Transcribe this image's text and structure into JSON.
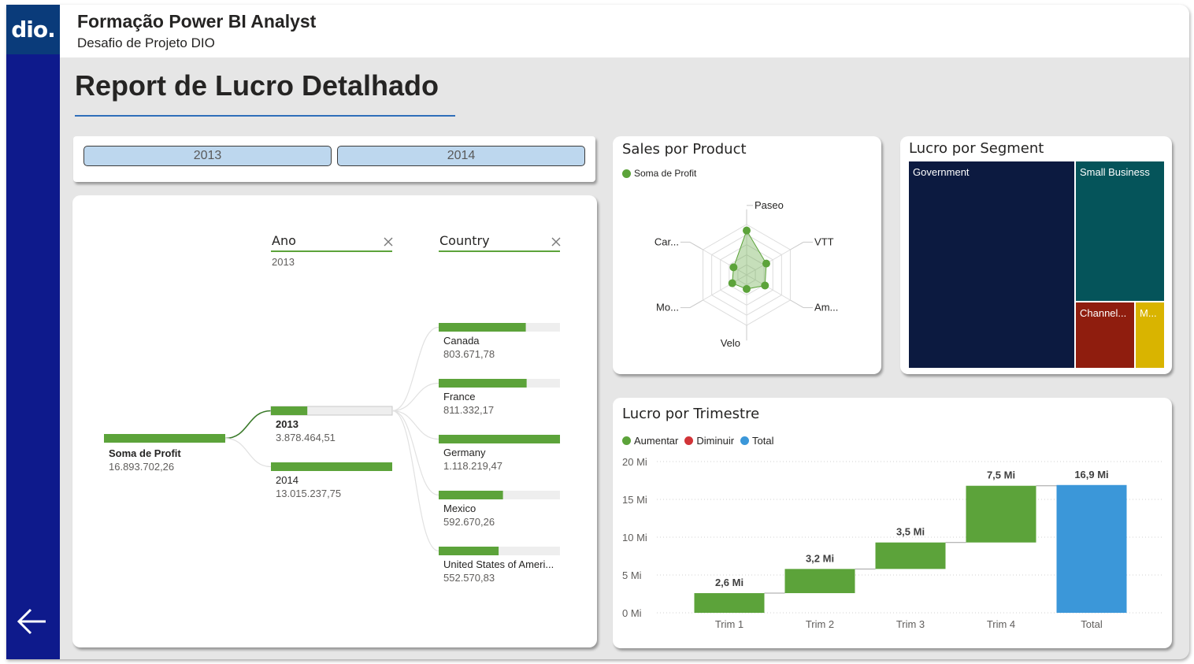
{
  "header": {
    "logo_text": "dio.",
    "title": "Formação Power BI Analyst",
    "subtitle": "Desafio de Projeto DIO"
  },
  "page_title": "Report de Lucro Detalhado",
  "slicer": {
    "options": [
      "2013",
      "2014"
    ]
  },
  "decomposition": {
    "levels": [
      {
        "label": "Ano",
        "value": "2013",
        "close_icon": "close-icon"
      },
      {
        "label": "Country",
        "value": "",
        "close_icon": "close-icon"
      }
    ],
    "root": {
      "label": "Soma de Profit",
      "value": "16.893.702,26"
    },
    "years": [
      {
        "label": "2013",
        "value": "3.878.464,51",
        "selected": true,
        "fill": 0.3
      },
      {
        "label": "2014",
        "value": "13.015.237,75",
        "selected": false,
        "fill": 1.0
      }
    ],
    "countries": [
      {
        "label": "Canada",
        "value": "803.671,78",
        "fill": 0.718
      },
      {
        "label": "France",
        "value": "811.332,17",
        "fill": 0.725
      },
      {
        "label": "Germany",
        "value": "1.118.219,47",
        "fill": 1.0
      },
      {
        "label": "Mexico",
        "value": "592.670,26",
        "fill": 0.53
      },
      {
        "label": "United States of Ameri...",
        "value": "552.570,83",
        "fill": 0.494
      }
    ],
    "colors": {
      "bar": "#5ca33a",
      "track": "#eeeeee",
      "line": "#3a7a2a"
    }
  },
  "radar": {
    "title": "Sales por Product",
    "legend": "Soma de Profit",
    "axes": [
      "Paseo",
      "VTT",
      "Am...",
      "Velo",
      "Mo...",
      "Car..."
    ],
    "values": [
      0.88,
      0.45,
      0.42,
      0.28,
      0.33,
      0.3
    ],
    "color": "#5ca33a"
  },
  "treemap": {
    "title": "Lucro por Segment",
    "cells": [
      {
        "label": "Government",
        "color": "#0c1a40"
      },
      {
        "label": "Small Business",
        "color": "#05545a"
      },
      {
        "label": "Channel...",
        "color": "#8f1d0e"
      },
      {
        "label": "M...",
        "color": "#d9b400"
      }
    ]
  },
  "waterfall": {
    "title": "Lucro por Trimestre",
    "legend": [
      {
        "label": "Aumentar",
        "color": "#5ca33a"
      },
      {
        "label": "Diminuir",
        "color": "#d13438"
      },
      {
        "label": "Total",
        "color": "#3b97d9"
      }
    ]
  },
  "chart_data": {
    "type": "bar",
    "subtype": "waterfall",
    "title": "Lucro por Trimestre",
    "categories": [
      "Trim 1",
      "Trim 2",
      "Trim 3",
      "Trim 4",
      "Total"
    ],
    "values": [
      2.6,
      3.2,
      3.5,
      7.5,
      16.9
    ],
    "value_labels": [
      "2,6 Mi",
      "3,2 Mi",
      "3,5 Mi",
      "7,5 Mi",
      "16,9 Mi"
    ],
    "kinds": [
      "increase",
      "increase",
      "increase",
      "increase",
      "total"
    ],
    "y_ticks": [
      "0 Mi",
      "5 Mi",
      "10 Mi",
      "15 Mi",
      "20 Mi"
    ],
    "ylim": [
      0,
      20
    ],
    "grid": true,
    "legend_position": "top-left"
  }
}
